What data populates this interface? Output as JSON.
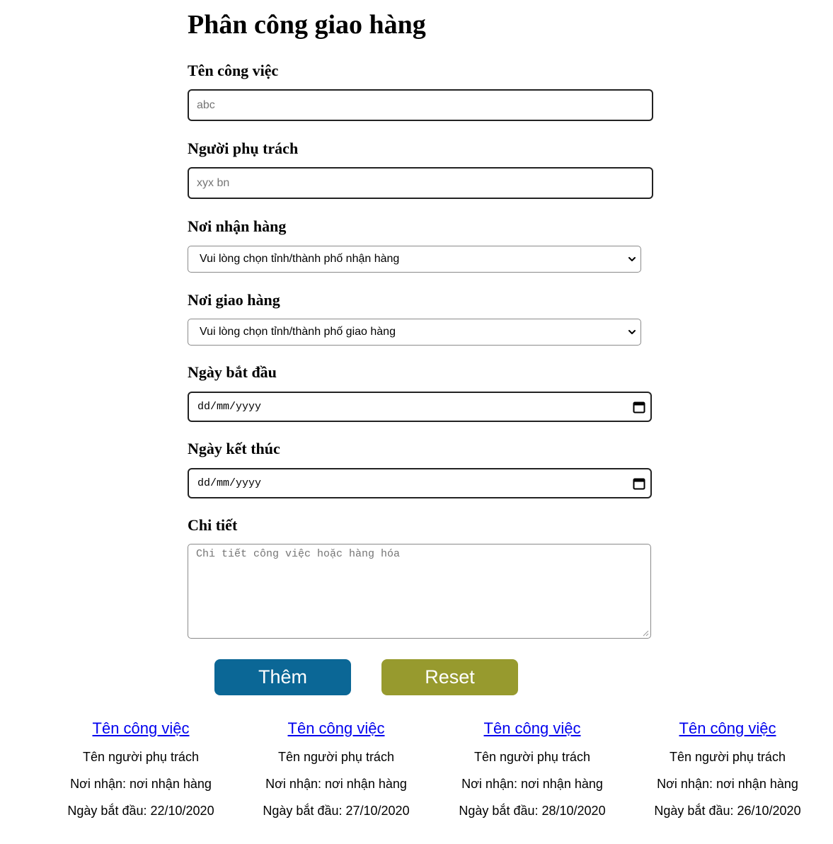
{
  "page": {
    "title": "Phân công giao hàng"
  },
  "form": {
    "task_name": {
      "label": "Tên công việc",
      "placeholder": "abc"
    },
    "person_in_charge": {
      "label": "Người phụ trách",
      "placeholder": "xyx bn"
    },
    "pickup_place": {
      "label": "Nơi nhận hàng",
      "selected": "Vui lòng chọn tỉnh/thành phố nhận hàng"
    },
    "delivery_place": {
      "label": "Nơi giao hàng",
      "selected": "Vui lòng chọn tỉnh/thành phố giao hàng"
    },
    "start_date": {
      "label": "Ngày bắt đầu",
      "value": "dd/mm/yyyy"
    },
    "end_date": {
      "label": "Ngày kết thúc",
      "value": "dd/mm/yyyy"
    },
    "details": {
      "label": "Chi tiết",
      "placeholder": "Chi tiết công việc hoặc hàng hóa"
    },
    "add_label": "Thêm",
    "reset_label": "Reset"
  },
  "colors": {
    "add_button": "#0b6796",
    "reset_button": "#979a2e",
    "link": "#0000ee"
  },
  "icons": {
    "select": "chevron-down-icon",
    "date": "calendar-icon",
    "textarea": "resize-handle-icon"
  },
  "cards": [
    {
      "title": "Tên công việc",
      "person": "Tên người phụ trách",
      "pickup": "Nơi nhận: nơi nhận hàng",
      "start": "Ngày bắt đầu: 22/10/2020"
    },
    {
      "title": "Tên công việc",
      "person": "Tên người phụ trách",
      "pickup": "Nơi nhận: nơi nhận hàng",
      "start": "Ngày bắt đầu: 27/10/2020"
    },
    {
      "title": "Tên công việc",
      "person": "Tên người phụ trách",
      "pickup": "Nơi nhận: nơi nhận hàng",
      "start": "Ngày bắt đầu: 28/10/2020"
    },
    {
      "title": "Tên công việc",
      "person": "Tên người phụ trách",
      "pickup": "Nơi nhận: nơi nhận hàng",
      "start": "Ngày bắt đầu: 26/10/2020"
    }
  ]
}
